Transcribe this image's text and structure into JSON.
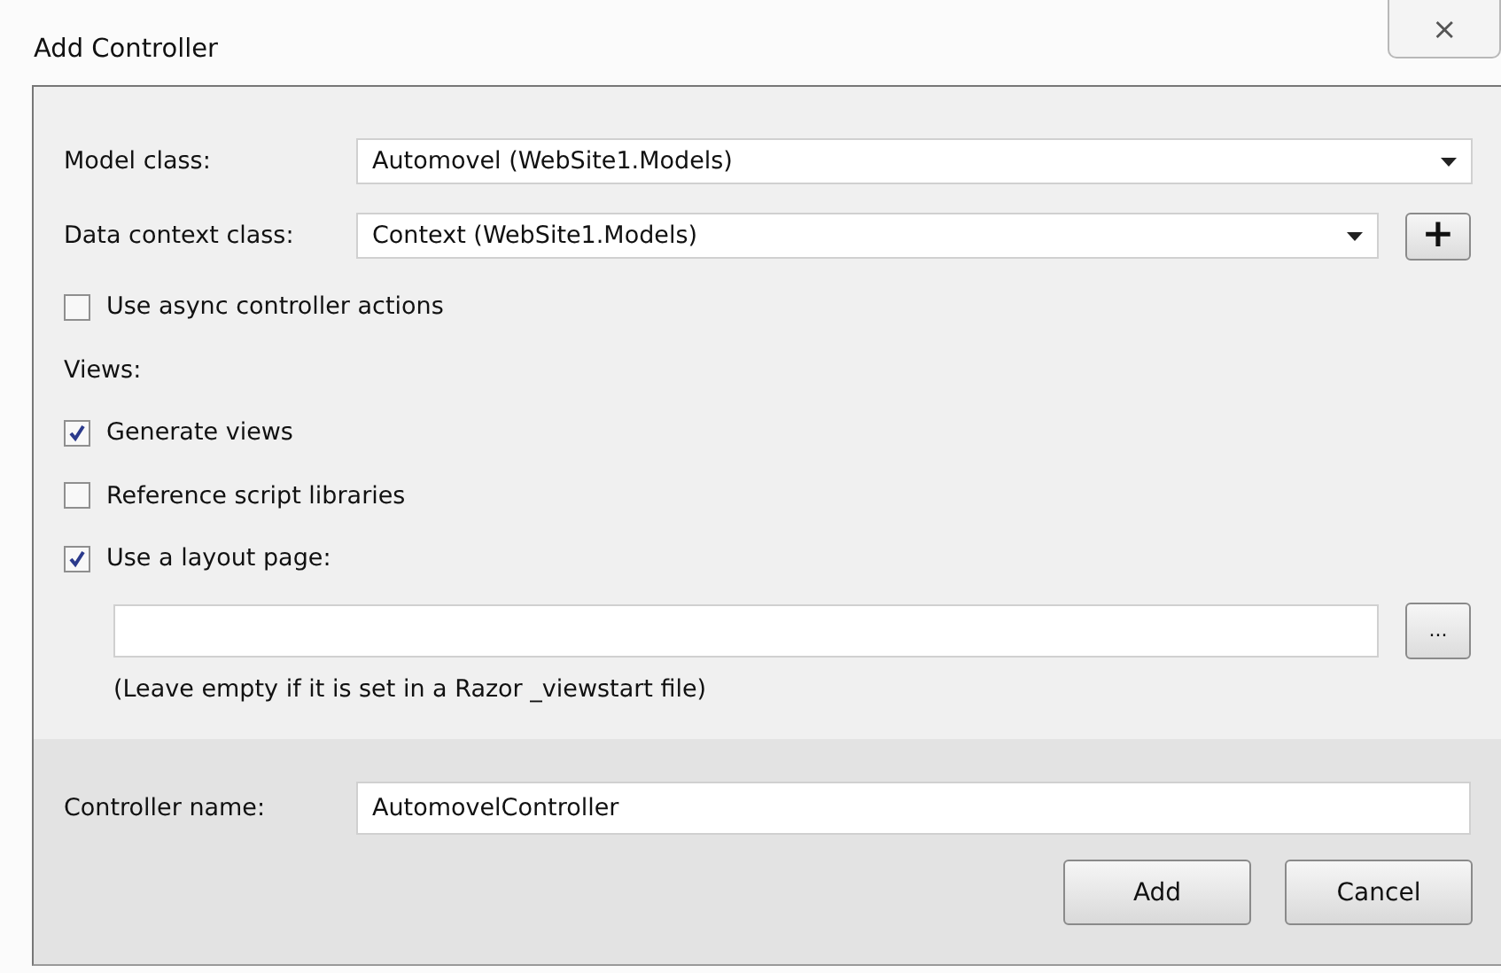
{
  "window": {
    "title": "Add Controller",
    "close": "⨯"
  },
  "fields": [
    {
      "label": "Model class:",
      "value": "Automovel (WebSite1.Models)",
      "kind": "dropdown"
    },
    {
      "label": "Data context class:",
      "value": "Context (WebSite1.Models)",
      "kind": "dropdown-add",
      "button": "+"
    }
  ],
  "options": [
    {
      "kind": "checkbox",
      "label": "Use async controller actions",
      "checked": false
    },
    {
      "kind": "heading",
      "label": "Views:"
    },
    {
      "kind": "checkbox",
      "label": "Generate views",
      "checked": true
    },
    {
      "kind": "checkbox",
      "label": "Reference script libraries",
      "checked": false
    },
    {
      "kind": "checkbox",
      "label": "Use a layout page:",
      "checked": true
    }
  ],
  "layout_page": {
    "browse_button": "...",
    "hint": "(Leave empty if it is set in a Razor _viewstart file)"
  },
  "controller_name": {
    "label": "Controller name:",
    "value": "AutomovelController"
  },
  "buttons": [
    "Add",
    "Cancel"
  ]
}
